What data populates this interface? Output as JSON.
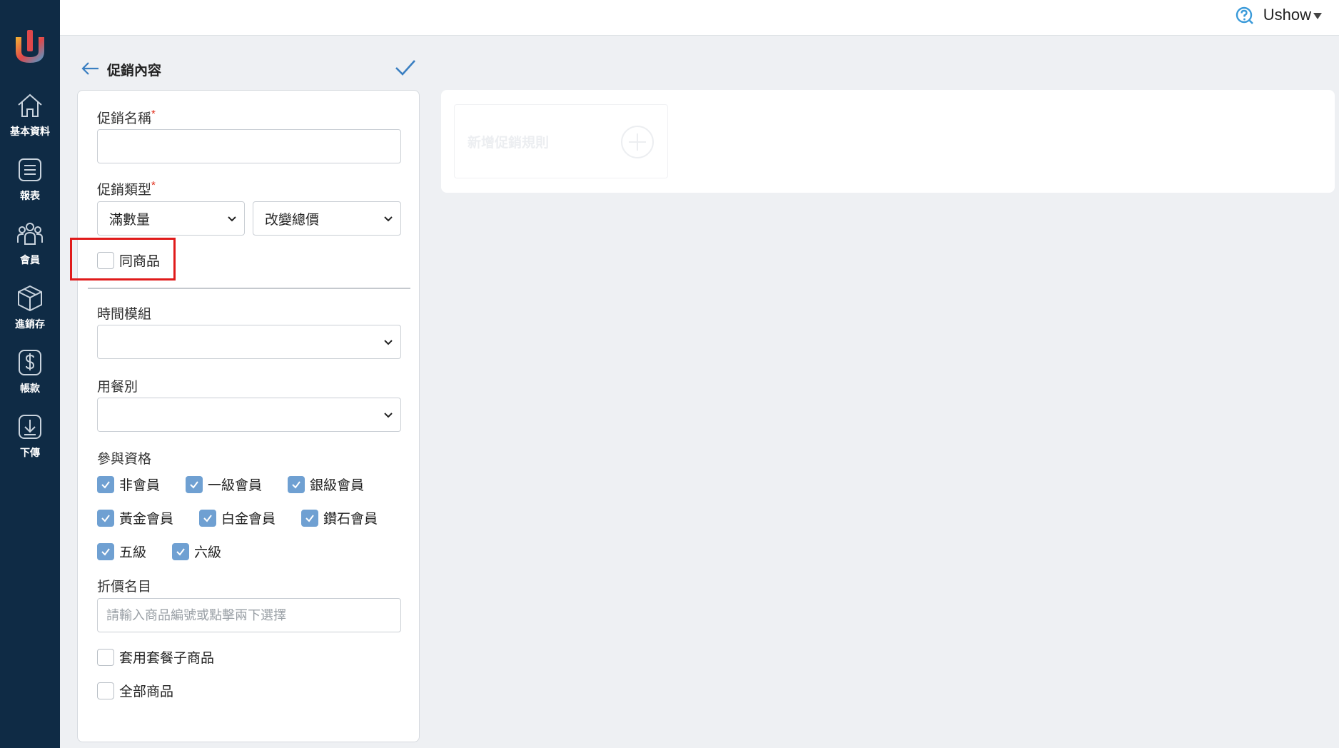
{
  "sidebar": {
    "logo": "ushow-logo",
    "items": [
      {
        "label": "基本資料",
        "icon": "home-icon"
      },
      {
        "label": "報表",
        "icon": "report-icon"
      },
      {
        "label": "會員",
        "icon": "members-icon"
      },
      {
        "label": "進銷存",
        "icon": "box-icon"
      },
      {
        "label": "帳款",
        "icon": "dollar-icon"
      },
      {
        "label": "下傳",
        "icon": "download-icon"
      }
    ]
  },
  "topbar": {
    "help_icon": "help-icon",
    "user_name": "Ushow"
  },
  "header": {
    "title": "促銷內容"
  },
  "form": {
    "promo_name": {
      "label": "促銷名稱",
      "required": "*",
      "value": ""
    },
    "promo_type": {
      "label": "促銷類型",
      "required": "*",
      "select1": "滿數量",
      "select2": "改變總價"
    },
    "same_product": {
      "label": "同商品",
      "checked": false
    },
    "time_module": {
      "label": "時間模組",
      "value": ""
    },
    "dining_type": {
      "label": "用餐別",
      "value": ""
    },
    "eligibility": {
      "label": "參與資格",
      "options": [
        {
          "label": "非會員",
          "checked": true
        },
        {
          "label": "一級會員",
          "checked": true
        },
        {
          "label": "銀級會員",
          "checked": true
        },
        {
          "label": "黃金會員",
          "checked": true
        },
        {
          "label": "白金會員",
          "checked": true
        },
        {
          "label": "鑽石會員",
          "checked": true
        },
        {
          "label": "五級",
          "checked": true
        },
        {
          "label": "六級",
          "checked": true
        }
      ]
    },
    "discount_items": {
      "label": "折價名目",
      "placeholder": "請輸入商品編號或點擊兩下選擇",
      "value": ""
    },
    "apply_combo": {
      "label": "套用套餐子商品",
      "checked": false
    },
    "all_products": {
      "label": "全部商品",
      "checked": false
    }
  },
  "rules_panel": {
    "add_rule_label": "新增促銷規則"
  },
  "colors": {
    "sidebar": "#0f2b45",
    "checkbox_checked": "#6fa0d2",
    "highlight": "#e01b1b",
    "accent": "#3a7fc1"
  }
}
